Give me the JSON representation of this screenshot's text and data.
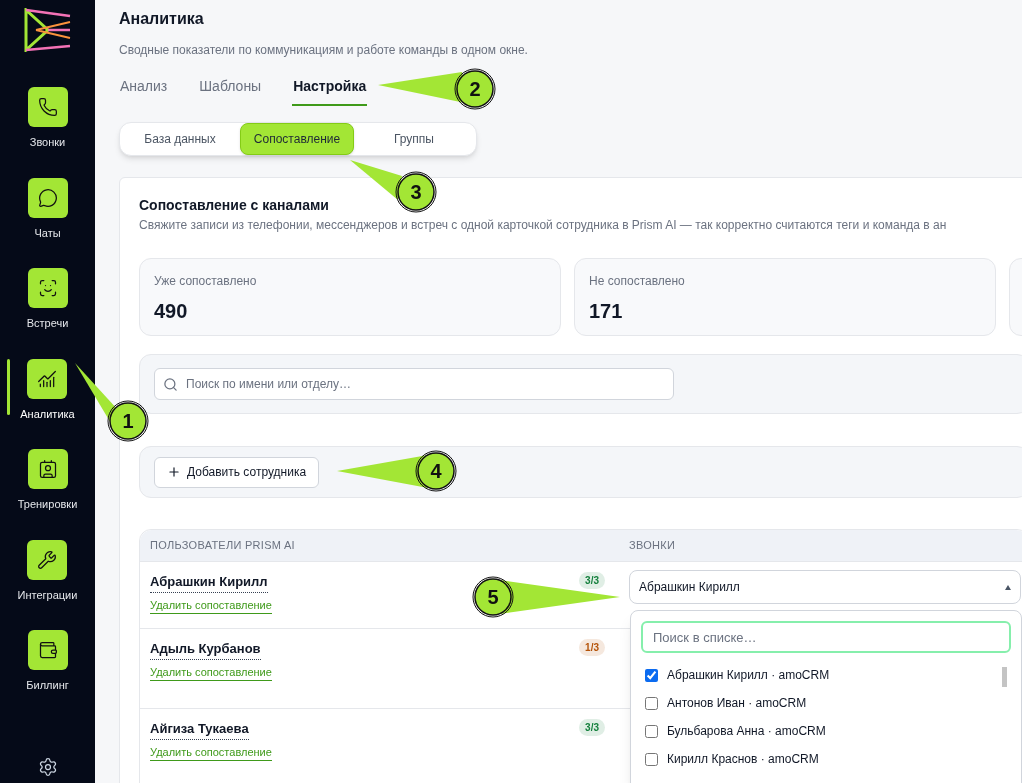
{
  "sidebar": {
    "items": [
      {
        "label": "Звонки",
        "selected": false
      },
      {
        "label": "Чаты",
        "selected": false
      },
      {
        "label": "Встречи",
        "selected": false
      },
      {
        "label": "Аналитика",
        "selected": true
      },
      {
        "label": "Тренировки",
        "selected": false
      },
      {
        "label": "Интеграции",
        "selected": false
      },
      {
        "label": "Биллинг",
        "selected": false
      }
    ]
  },
  "page": {
    "title": "Аналитика",
    "subtitle": "Сводные показатели по коммуникациям и работе команды в одном окне."
  },
  "tabs": [
    {
      "label": "Анализ",
      "selected": false
    },
    {
      "label": "Шаблоны",
      "selected": false
    },
    {
      "label": "Настройка",
      "selected": true
    }
  ],
  "subtabs": [
    {
      "label": "База данных",
      "selected": false
    },
    {
      "label": "Сопоставление",
      "selected": true
    },
    {
      "label": "Группы",
      "selected": false
    }
  ],
  "section": {
    "title": "Сопоставление с каналами",
    "description": "Свяжите записи из телефонии, мессенджеров и встреч с одной карточкой сотрудника в Prism AI — так корректно считаются теги и команда в ан"
  },
  "stats": [
    {
      "label": "Уже сопоставлено",
      "value": "490"
    },
    {
      "label": "Не сопоставлено",
      "value": "171"
    }
  ],
  "search": {
    "placeholder": "Поиск по имени или отделу…"
  },
  "add_button": {
    "label": "Добавить сотрудника"
  },
  "table": {
    "columns": [
      "ПОЛЬЗОВАТЕЛИ PRISM AI",
      "ЗВОНКИ"
    ],
    "rows": [
      {
        "name": "Абрашкин Кирилл",
        "link": "Удалить сопоставление",
        "badge": "3/3",
        "color": "#15803d"
      },
      {
        "name": "Адыль Курбанов",
        "link": "Удалить сопоставление",
        "badge": "1/3",
        "color": "#b45309"
      },
      {
        "name": "Айгиза Тукаева",
        "link": "Удалить сопоставление",
        "badge": "3/3",
        "color": "#15803d"
      }
    ]
  },
  "select": {
    "value": "Абрашкин Кирилл",
    "expanded": true,
    "search_placeholder": "Поиск в списке…",
    "options": [
      {
        "label": "Абрашкин Кирилл · amoCRM",
        "checked": true
      },
      {
        "label": "Антонов Иван · amoCRM",
        "checked": false
      },
      {
        "label": "Бульбарова Анна · amoCRM",
        "checked": false
      },
      {
        "label": "Кирилл Краснов · amoCRM",
        "checked": false
      }
    ]
  },
  "callouts": [
    {
      "number": "1"
    },
    {
      "number": "2"
    },
    {
      "number": "3"
    },
    {
      "number": "4"
    },
    {
      "number": "5"
    }
  ]
}
